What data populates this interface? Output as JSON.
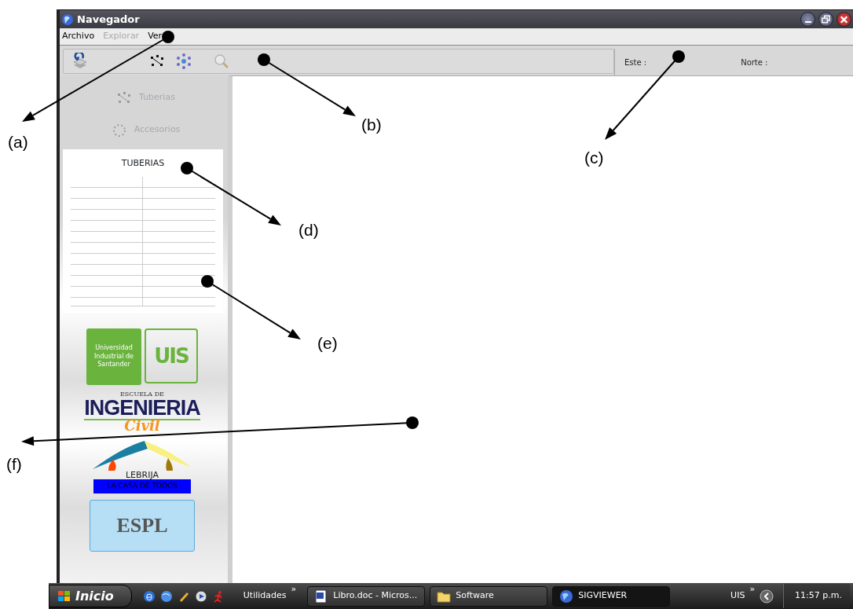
{
  "window": {
    "title": "Navegador"
  },
  "menu": [
    {
      "label": "Archivo",
      "disabled": false
    },
    {
      "label": "Explorar",
      "disabled": true
    },
    {
      "label": "Ver",
      "disabled": false
    }
  ],
  "toolbar": [
    {
      "kind": "layers",
      "disabled": false
    },
    {
      "kind": "nodes",
      "disabled": false
    },
    {
      "kind": "network",
      "disabled": false
    },
    {
      "kind": "zoom",
      "disabled": true
    }
  ],
  "coordinates": [
    {
      "label": "Este :"
    },
    {
      "label": "Norte :"
    }
  ],
  "sidebar": {
    "layers": [
      {
        "label": "Tuberias",
        "kind": "nodes",
        "disabled": true
      },
      {
        "label": "Accesorios",
        "kind": "ring",
        "disabled": true
      }
    ],
    "panel_title": "TUBERIAS",
    "logos": {
      "uis_name": "Universidad Industrial de Santander",
      "uis_mark": "UIS",
      "school_top": "ESCUELA DE",
      "school_main": "INGENIERIA",
      "school_script": "Civil",
      "town": "LEBRIJA",
      "town_motto": "LA CASA DE TODOS",
      "espl": "ESPL"
    }
  },
  "annotations": [
    {
      "label": "(a)"
    },
    {
      "label": "(b)"
    },
    {
      "label": "(c)"
    },
    {
      "label": "(d)"
    },
    {
      "label": "(e)"
    },
    {
      "label": "(f)"
    }
  ],
  "taskbar": {
    "start": "Inicio",
    "quick_launch": "Utilidades",
    "chevron": "»",
    "tasks": [
      {
        "label": "Libro.doc - Micros...",
        "kind": "document",
        "selected": false
      },
      {
        "label": "Software",
        "kind": "folder",
        "selected": false
      },
      {
        "label": "SIGVIEWER",
        "kind": "globe",
        "selected": true
      }
    ],
    "tray_label": "UIS",
    "tray_chevron": "»",
    "clock": "11:57 p.m."
  }
}
